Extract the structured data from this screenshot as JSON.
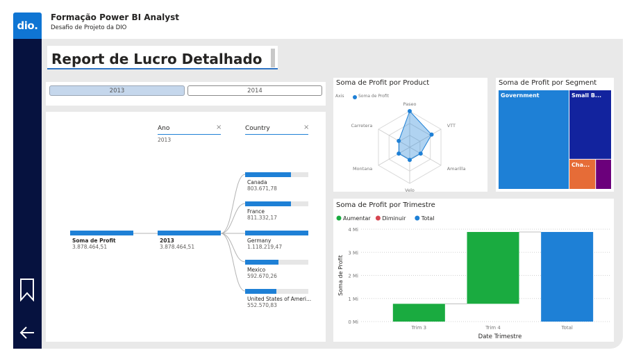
{
  "app": {
    "logo_text": "dio.",
    "title": "Formação Power BI Analyst",
    "subtitle": "Desafio de Projeto da DIO"
  },
  "nav": {
    "icons": [
      "bookmark-icon",
      "back-arrow-icon"
    ]
  },
  "page": {
    "title": "Report de Lucro Detalhado"
  },
  "slicer": {
    "options": [
      {
        "label": "2013",
        "selected": true
      },
      {
        "label": "2014",
        "selected": false
      }
    ]
  },
  "decomposition": {
    "root": {
      "label": "Soma de Profit",
      "value": "3.878.464,51"
    },
    "level1": {
      "header": "Ano",
      "filter": "2013",
      "close": "×",
      "label": "2013",
      "value": "3.878.464,51"
    },
    "level2": {
      "header": "Country",
      "close": "×",
      "items": [
        {
          "label": "Canada",
          "value": "803.671,78",
          "share": 0.72
        },
        {
          "label": "France",
          "value": "811.332,17",
          "share": 0.73
        },
        {
          "label": "Germany",
          "value": "1.118.219,47",
          "share": 1.0
        },
        {
          "label": "Mexico",
          "value": "592.670,26",
          "share": 0.53
        },
        {
          "label": "United States of Ameri...",
          "value": "552.570,83",
          "share": 0.49
        }
      ]
    }
  },
  "radar": {
    "title": "Soma de Profit por Product",
    "legend_axis": "Axis",
    "legend_series": "Soma de Profit",
    "series_color": "#1e80d6"
  },
  "treemap": {
    "title": "Soma de Profit por Segment",
    "labels": [
      "Government",
      "Small B...",
      "Cha..."
    ]
  },
  "chart_data": [
    {
      "type": "radar",
      "title": "Soma de Profit por Product",
      "categories": [
        "Paseo",
        "VTT",
        "Amarilla",
        "Velo",
        "Montana",
        "Carretera"
      ],
      "series": [
        {
          "name": "Soma de Profit",
          "values": [
            1.0,
            0.7,
            0.35,
            0.35,
            0.35,
            0.35
          ]
        }
      ]
    },
    {
      "type": "treemap",
      "title": "Soma de Profit por Segment",
      "categories": [
        "Government",
        "Small B...",
        "Cha...",
        ""
      ],
      "values": [
        0.63,
        0.26,
        0.07,
        0.04
      ],
      "colors": [
        "#1e80d6",
        "#12239e",
        "#e66c37",
        "#6b007b"
      ]
    },
    {
      "type": "bar",
      "subtype": "waterfall",
      "title": "Soma de Profit por Trimestre",
      "categories": [
        "Trim 3",
        "Trim 4",
        "Total"
      ],
      "starts": [
        0,
        0.77,
        0
      ],
      "ends": [
        0.77,
        3.88,
        3.88
      ],
      "kinds": [
        "increase",
        "increase",
        "total"
      ],
      "xlabel": "Date Trimestre",
      "ylabel": "Soma de Profit",
      "ylim": [
        0,
        4
      ],
      "yticks": [
        "0 Mi",
        "1 Mi",
        "2 Mi",
        "3 Mi",
        "4 Mi"
      ],
      "legend": [
        "Aumentar",
        "Diminuir",
        "Total"
      ],
      "colors": {
        "increase": "#1aab40",
        "decrease": "#d64550",
        "total": "#1e80d6"
      }
    }
  ]
}
